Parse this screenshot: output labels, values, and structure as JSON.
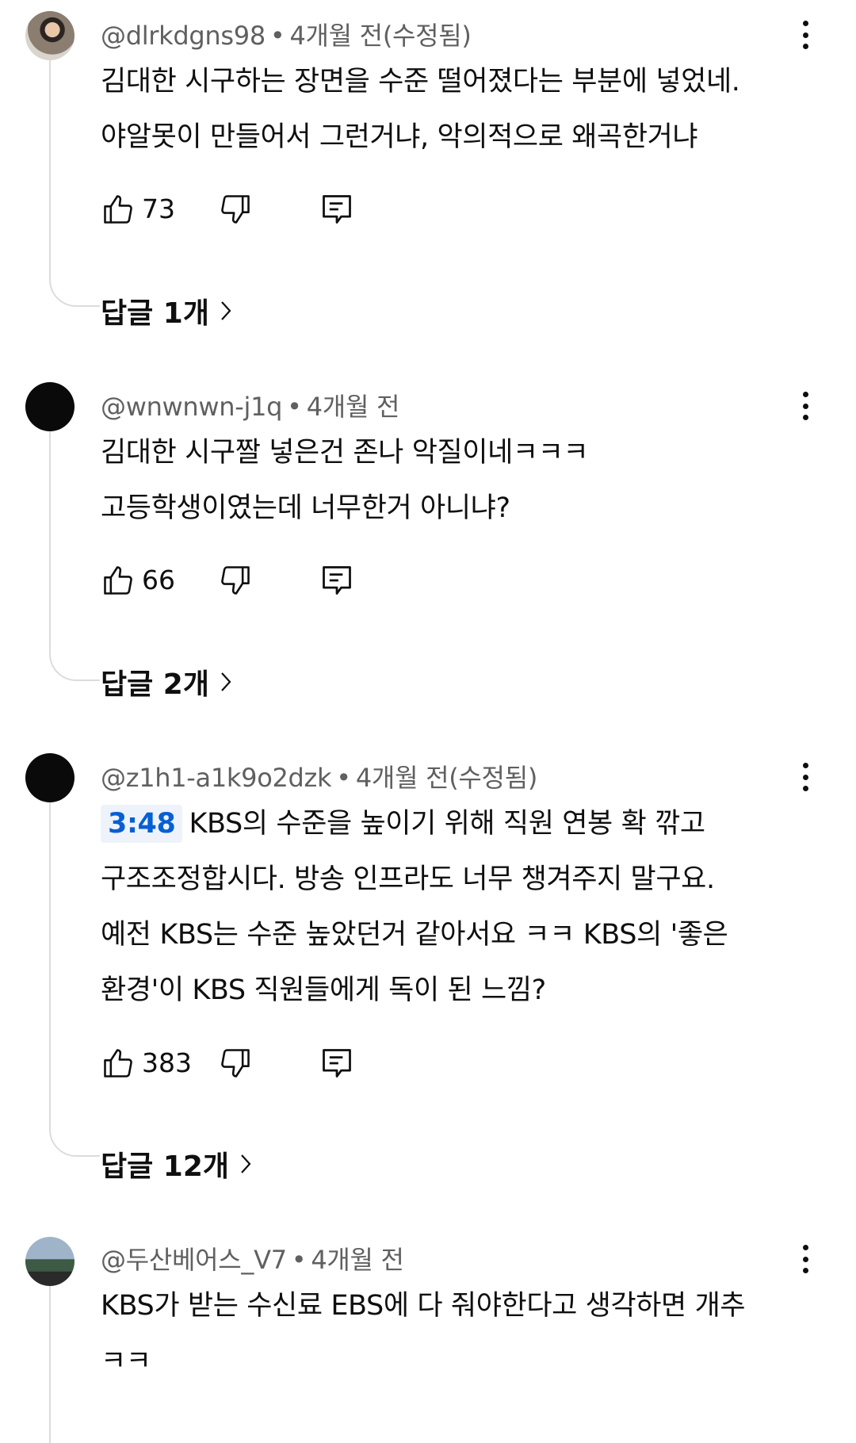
{
  "comments": [
    {
      "handle": "@dlrkdgns98",
      "time": "4개월 전(수정됨)",
      "text_lines": [
        "김대한 시구하는 장면을 수준 떨어졌다는 부분에 넣었네.",
        "야알못이 만들어서 그런거냐, 악의적으로 왜곡한거냐"
      ],
      "likes": "73",
      "replies": "답글 1개"
    },
    {
      "handle": "@wnwnwn-j1q",
      "time": "4개월 전",
      "text_lines": [
        "김대한 시구짤 넣은건 존나 악질이네ㅋㅋㅋ",
        "고등학생이였는데 너무한거 아니냐?"
      ],
      "likes": "66",
      "replies": "답글 2개"
    },
    {
      "handle": "@z1h1-a1k9o2dzk",
      "time": "4개월 전(수정됨)",
      "timestamp_link": "3:48",
      "text_lines": [
        "KBS의 수준을 높이기 위해 직원 연봉 확 깎고",
        "구조조정합시다. 방송 인프라도 너무 챙겨주지 말구요.",
        "예전 KBS는 수준 높았던거 같아서요 ㅋㅋ KBS의 '좋은",
        "환경'이 KBS 직원들에게 독이 된 느낌?"
      ],
      "likes": "383",
      "replies": "답글 12개"
    },
    {
      "handle": "@두산베어스_V7",
      "time": "4개월 전",
      "text_lines": [
        "KBS가 받는 수신료 EBS에 다 줘야한다고 생각하면 개추",
        "ㅋㅋ"
      ]
    }
  ],
  "separator": "•",
  "icons": {
    "avatar": "avatar",
    "like": "thumbs-up-icon",
    "dislike": "thumbs-down-icon",
    "reply": "reply-comment-icon",
    "more": "more-vertical-icon",
    "chevron": "chevron-right-icon"
  },
  "colors": {
    "text": "#0f0f0f",
    "meta": "#606060",
    "link": "#065fd4",
    "thread": "#dcdcdc"
  }
}
